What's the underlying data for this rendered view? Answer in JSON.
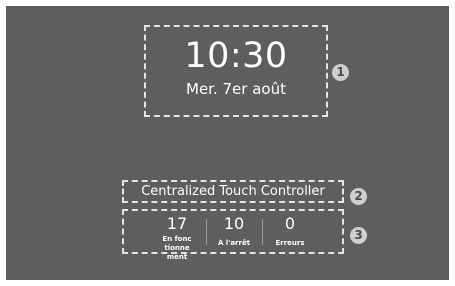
{
  "clock": {
    "time": "10:30",
    "date": "Mer. 7er août"
  },
  "controller": {
    "title": "Centralized Touch Controller"
  },
  "stats": [
    {
      "value": "17",
      "label": "En fonctionnement"
    },
    {
      "value": "10",
      "label": "À l'arrêt"
    },
    {
      "value": "0",
      "label": "Erreurs"
    }
  ],
  "callouts": [
    "1",
    "2",
    "3"
  ]
}
